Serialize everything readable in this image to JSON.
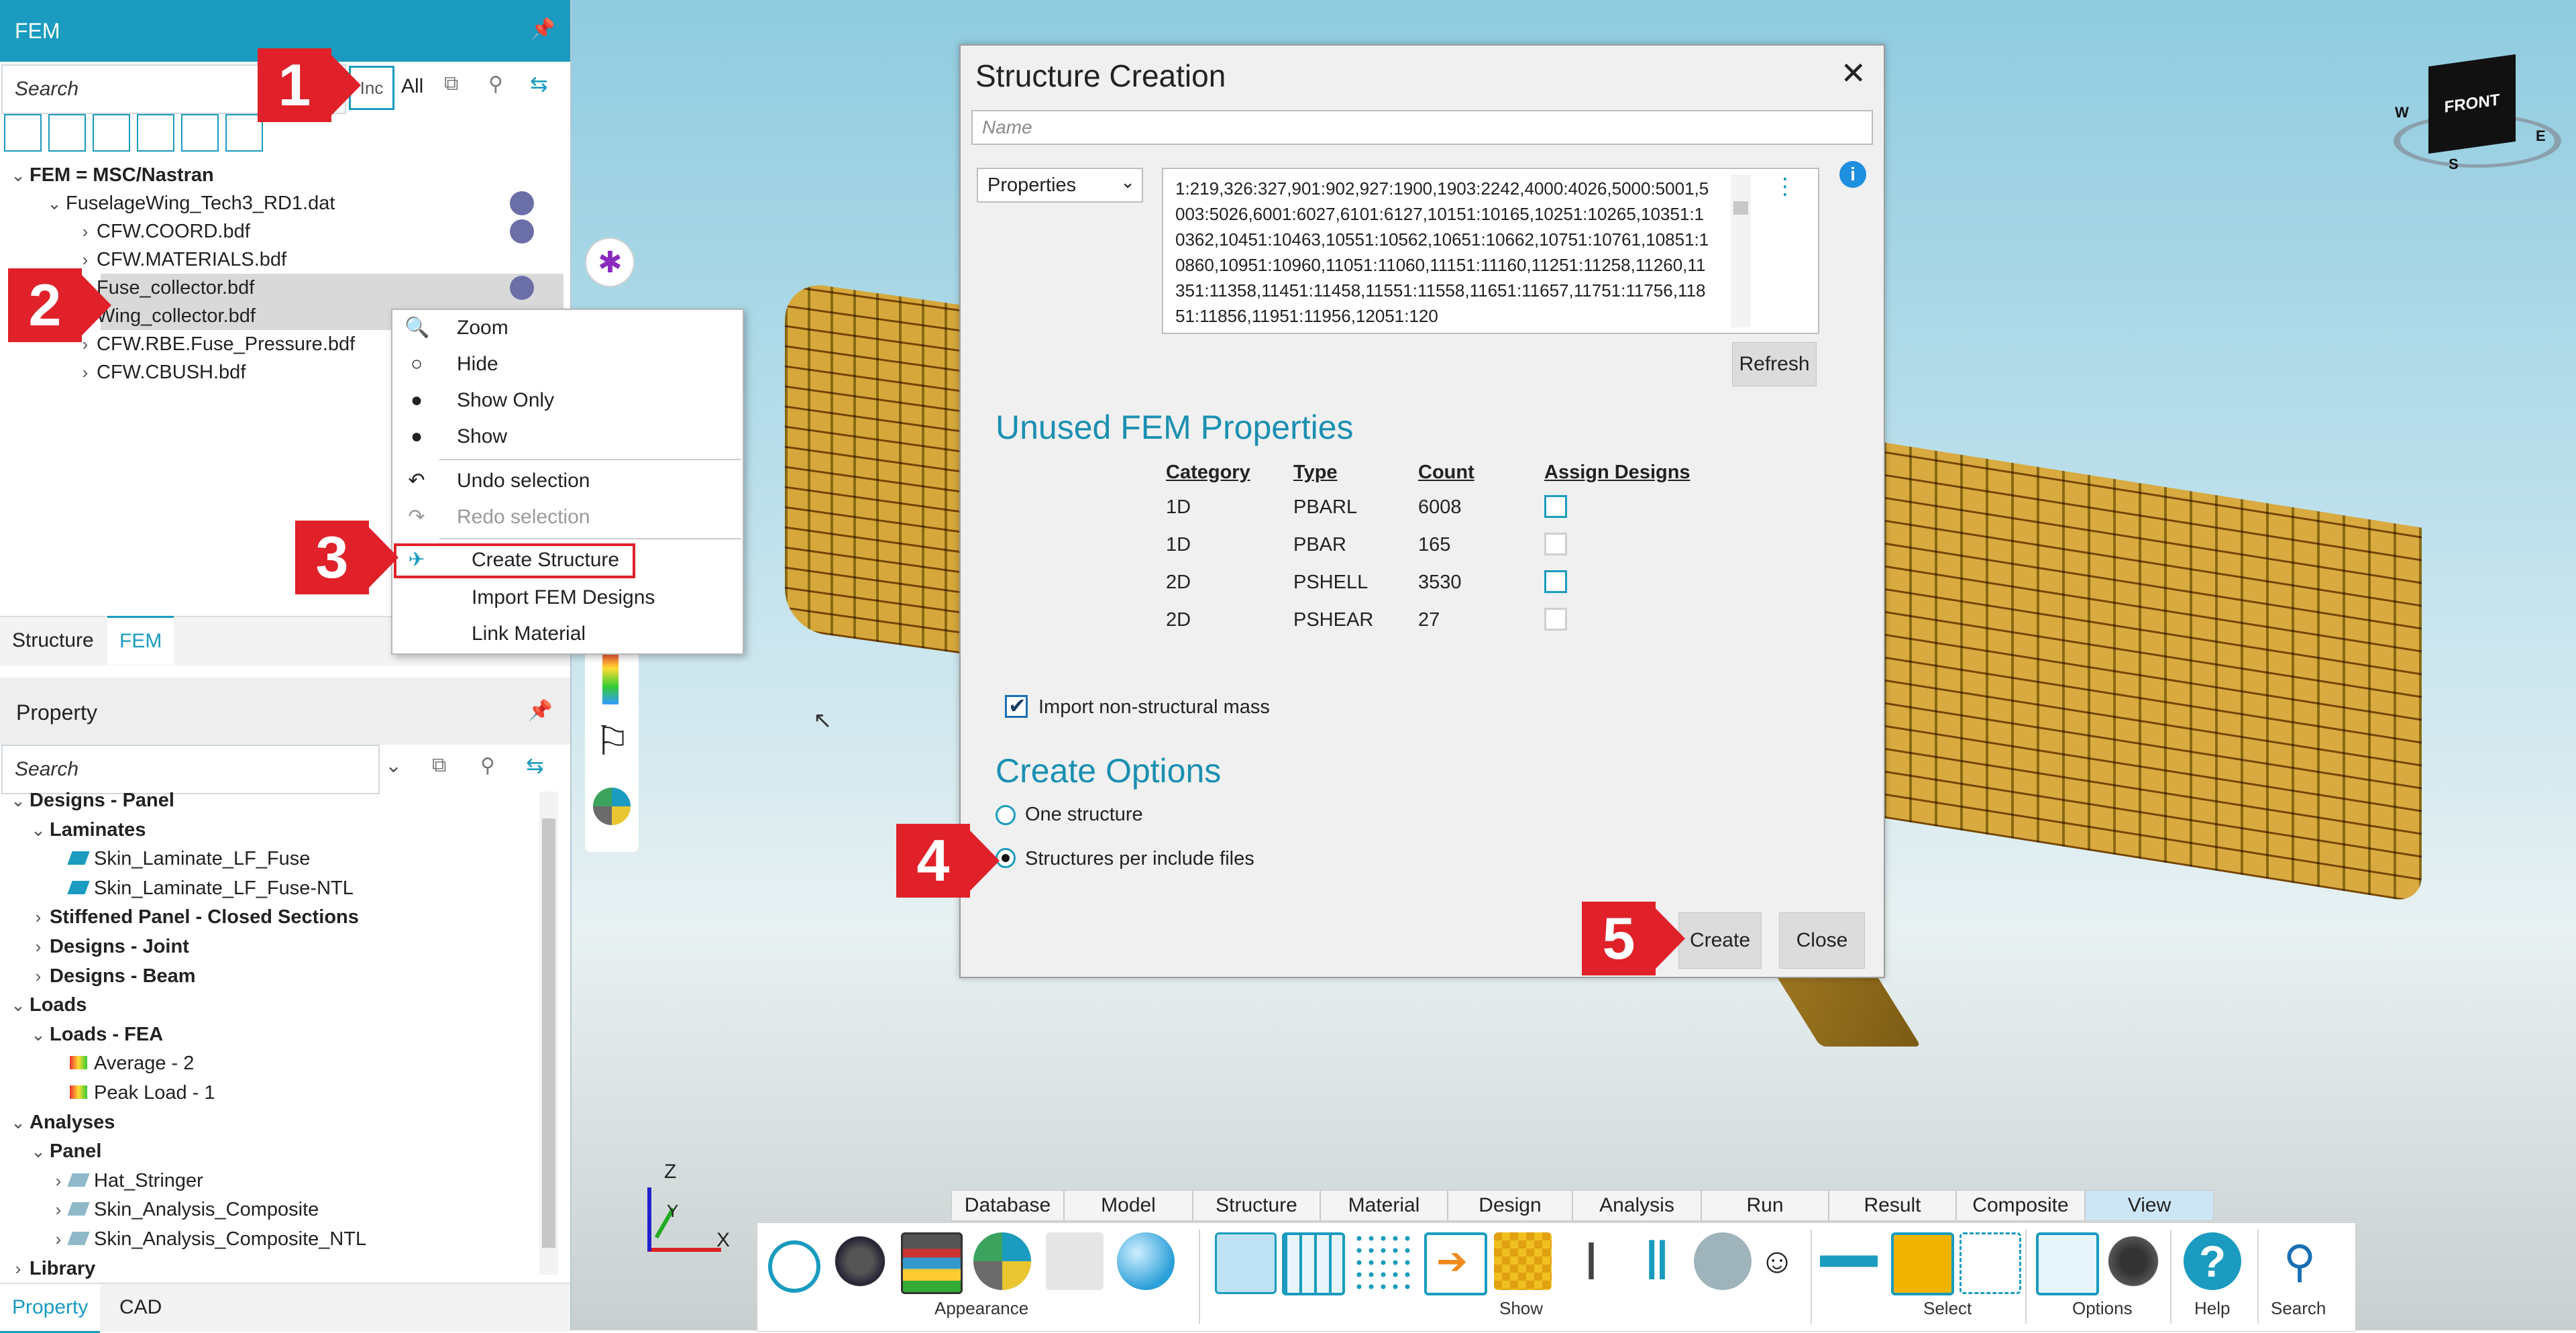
{
  "fem_panel": {
    "title": "FEM",
    "search_placeholder": "Search",
    "filter_inc": "Inc",
    "filter_all": "All",
    "tree": {
      "root": "FEM = MSC/Nastran",
      "file": "FuselageWing_Tech3_RD1.dat",
      "items": [
        "CFW.COORD.bdf",
        "CFW.MATERIALS.bdf",
        "Fuse_collector.bdf",
        "Wing_collector.bdf",
        "CFW.RBE.Fuse_Pressure.bdf",
        "CFW.CBUSH.bdf"
      ]
    },
    "tabs": [
      "Structure",
      "FEM"
    ]
  },
  "property_panel": {
    "title": "Property",
    "search_placeholder": "Search",
    "tree": [
      {
        "label": "Designs - Panel",
        "level": 0,
        "expanded": true
      },
      {
        "label": "Laminates",
        "level": 1,
        "expanded": true
      },
      {
        "label": "Skin_Laminate_LF_Fuse",
        "level": 2
      },
      {
        "label": "Skin_Laminate_LF_Fuse-NTL",
        "level": 2
      },
      {
        "label": "Stiffened Panel - Closed Sections",
        "level": 1
      },
      {
        "label": "Designs - Joint",
        "level": 1
      },
      {
        "label": "Designs - Beam",
        "level": 1
      },
      {
        "label": "Loads",
        "level": 0,
        "expanded": true
      },
      {
        "label": "Loads - FEA",
        "level": 1,
        "expanded": true
      },
      {
        "label": "Average - 2",
        "level": 2
      },
      {
        "label": "Peak Load - 1",
        "level": 2
      },
      {
        "label": "Analyses",
        "level": 0,
        "expanded": true
      },
      {
        "label": "Panel",
        "level": 1,
        "expanded": true
      },
      {
        "label": "Hat_Stringer",
        "level": 2
      },
      {
        "label": "Skin_Analysis_Composite",
        "level": 2
      },
      {
        "label": "Skin_Analysis_Composite_NTL",
        "level": 2
      },
      {
        "label": "Library",
        "level": 0
      }
    ],
    "tabs": [
      "Property",
      "CAD"
    ]
  },
  "context_menu": {
    "items": [
      "Zoom",
      "Hide",
      "Show Only",
      "Show",
      "Undo selection",
      "Redo selection",
      "Create Structure",
      "Import FEM Designs",
      "Link Material"
    ]
  },
  "callouts": [
    "1",
    "2",
    "3",
    "4",
    "5"
  ],
  "dialog": {
    "title": "Structure Creation",
    "name_placeholder": "Name",
    "dropdown": "Properties",
    "ids_text": "1:219,326:327,901:902,927:1900,1903:2242,4000:4026,5000:5001,5003:5026,6001:6027,6101:6127,10151:10165,10251:10265,10351:10362,10451:10463,10551:10562,10651:10662,10751:10761,10851:10860,10951:10960,11051:11060,11151:11160,11251:11258,11260,11351:11358,11451:11458,11551:11558,11651:11657,11751:11756,11851:11856,11951:11956,12051:120",
    "refresh": "Refresh",
    "unused_heading": "Unused FEM Properties",
    "columns": [
      "Category",
      "Type",
      "Count",
      "Assign Designs"
    ],
    "rows": [
      {
        "category": "1D",
        "type": "PBARL",
        "count": "6008"
      },
      {
        "category": "1D",
        "type": "PBAR",
        "count": "165"
      },
      {
        "category": "2D",
        "type": "PSHELL",
        "count": "3530"
      },
      {
        "category": "2D",
        "type": "PSHEAR",
        "count": "27"
      }
    ],
    "import_mass": "Import non-structural mass",
    "options_heading": "Create Options",
    "option_one": "One structure",
    "option_per": "Structures per include files",
    "create": "Create",
    "close": "Close"
  },
  "viewcube": {
    "front": "FRONT",
    "w": "W",
    "s": "S",
    "e": "E"
  },
  "axes": {
    "z": "Z",
    "y": "Y",
    "x": "X"
  },
  "ribbon": {
    "tabs": [
      "Database",
      "Model",
      "Structure",
      "Material",
      "Design",
      "Analysis",
      "Run",
      "Result",
      "Composite",
      "View"
    ],
    "groups": [
      "Appearance",
      "Show",
      "Select",
      "Options",
      "Help",
      "Search"
    ]
  },
  "colors": {
    "accent": "#1a9bbf",
    "callout": "#e0212a",
    "mesh": "#d6a83b"
  }
}
